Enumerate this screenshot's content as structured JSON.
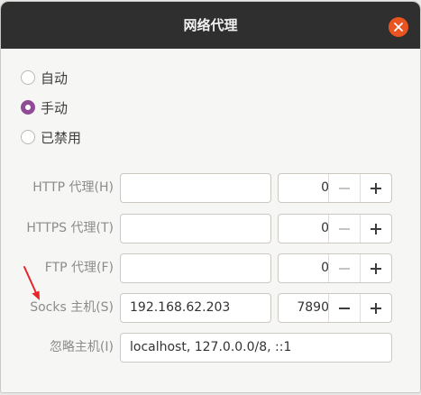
{
  "dialog": {
    "title": "网络代理",
    "close_icon": "close-icon",
    "accent_color": "#e95420",
    "selection_color": "#8f4b96"
  },
  "mode": {
    "options": [
      {
        "label": "自动",
        "checked": false
      },
      {
        "label": "手动",
        "checked": true
      },
      {
        "label": "已禁用",
        "checked": false
      }
    ]
  },
  "proxies": {
    "http": {
      "label": "HTTP 代理(H)",
      "host": "",
      "port": "0",
      "minus_enabled": false
    },
    "https": {
      "label": "HTTPS 代理(T)",
      "host": "",
      "port": "0",
      "minus_enabled": false
    },
    "ftp": {
      "label": "FTP 代理(F)",
      "host": "",
      "port": "0",
      "minus_enabled": false
    },
    "socks": {
      "label": "Socks 主机(S)",
      "host": "192.168.62.203",
      "port": "7890",
      "minus_enabled": true
    }
  },
  "ignore_hosts": {
    "label": "忽略主机(I)",
    "value": "localhost, 127.0.0.0/8, ::1"
  },
  "annotation": {
    "icon": "red-arrow-icon",
    "color": "#e8242b"
  }
}
